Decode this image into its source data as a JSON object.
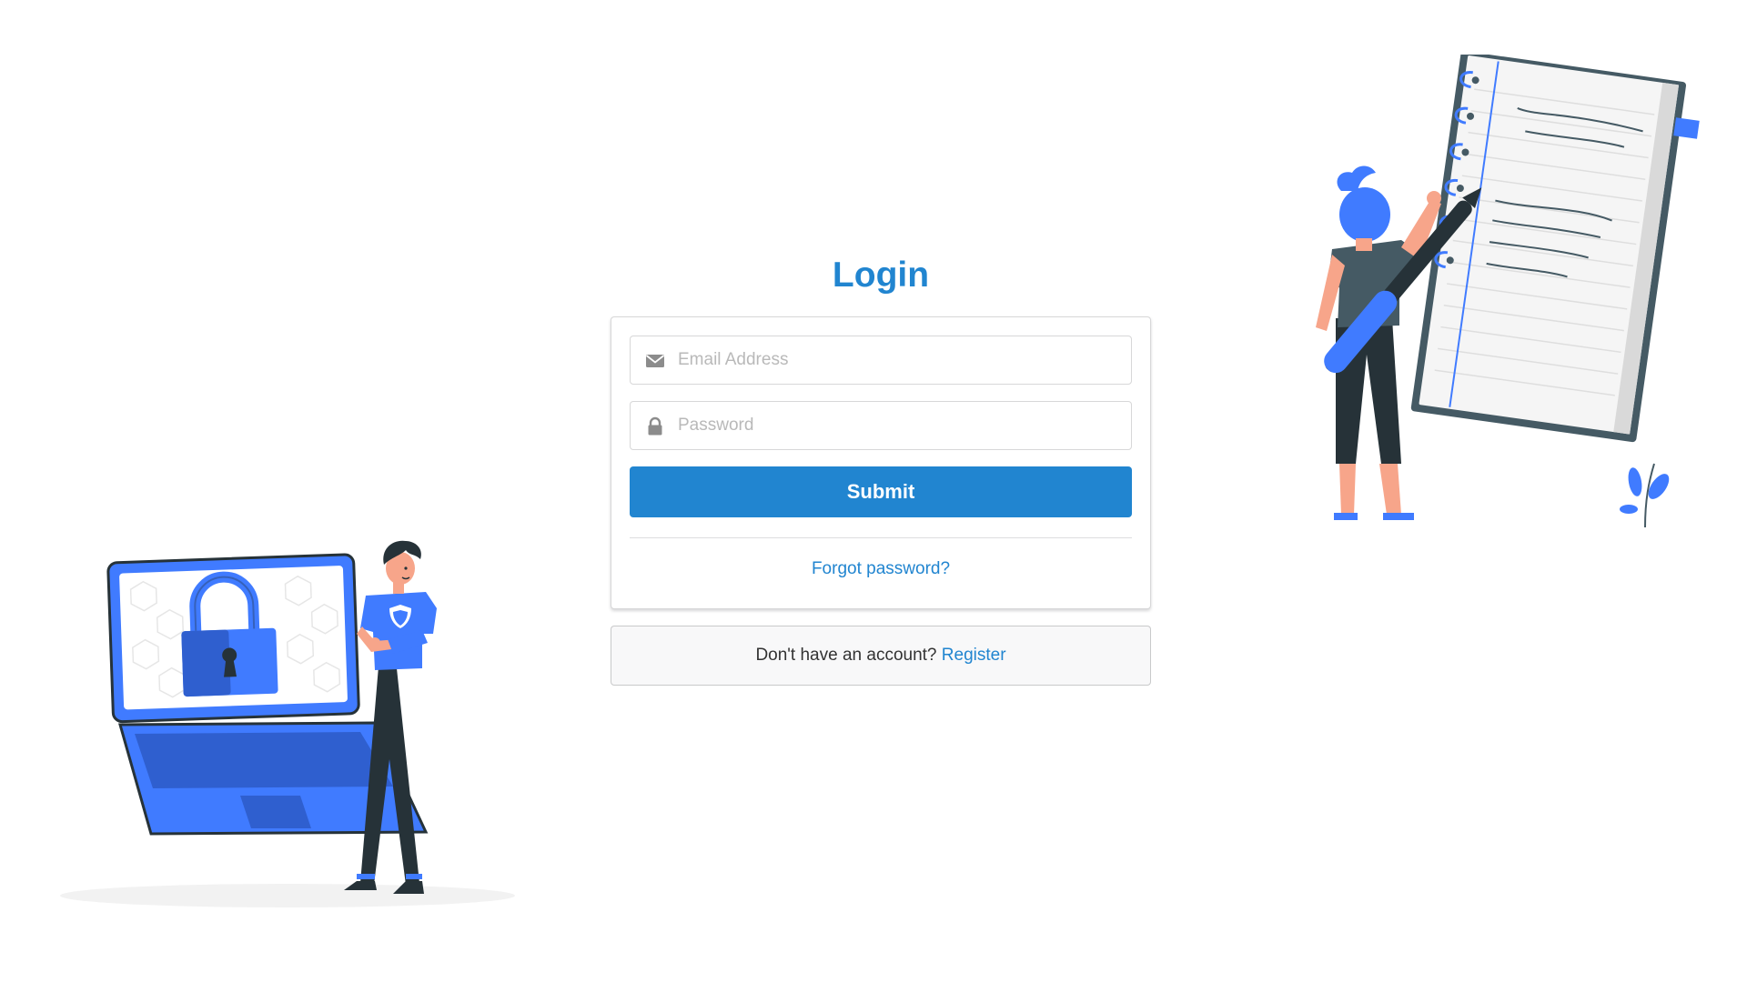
{
  "login": {
    "title": "Login",
    "email": {
      "placeholder": "Email Address",
      "icon": "envelope-icon"
    },
    "password": {
      "placeholder": "Password",
      "icon": "lock-icon"
    },
    "submit_label": "Submit",
    "forgot_label": "Forgot password?"
  },
  "register": {
    "prompt": "Don't have an account?",
    "link_label": "Register"
  },
  "colors": {
    "primary": "#2185d0",
    "illustration_blue": "#407BFF",
    "illustration_dark": "#263238"
  }
}
